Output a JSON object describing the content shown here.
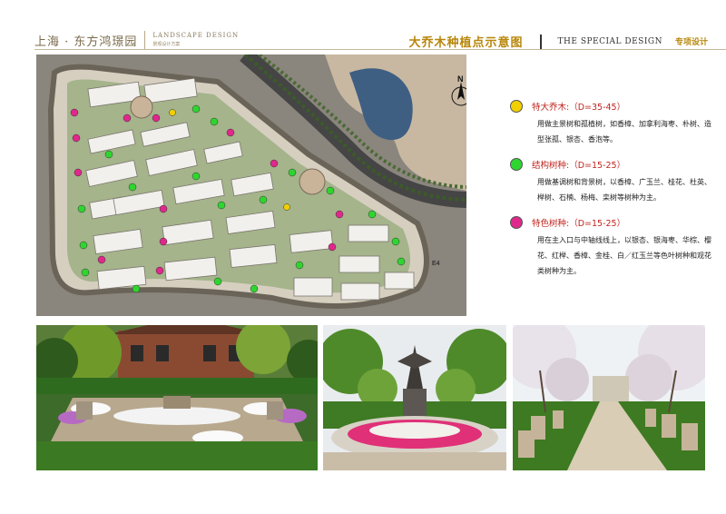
{
  "header": {
    "brand": "上海 · 东方鸿璟园",
    "brand_en": "LANDSCAPE DESIGN",
    "brand_cn": "景观设计方案",
    "plan_title": "大乔木种植点示意图",
    "special_en": "THE SPECIAL DESIGN",
    "special_cn": "专项设计"
  },
  "plan": {
    "north_label": "N",
    "road_label": "E4"
  },
  "legend": [
    {
      "title": "特大乔木:（D=35-45）",
      "color": "#f2d000",
      "desc": "用做主景树和孤植树，如香樟、加拿利海枣、朴树、造型张孤、银杏、香泡等。"
    },
    {
      "title": "结构树种:（D=15-25）",
      "color": "#2fd52f",
      "desc": "用做基调树和背景树，以香樟、广玉兰、桂花、杜英、榉树、石楠、杨梅、栾树等树种为主。"
    },
    {
      "title": "特色树种:（D=15-25）",
      "color": "#e0288c",
      "desc": "用在主入口与中轴线线上，以银杏、银海枣、华棕、樱花、红榉、香樟、金桂、白／红玉兰等色叶树种和观花类树种为主。"
    }
  ]
}
